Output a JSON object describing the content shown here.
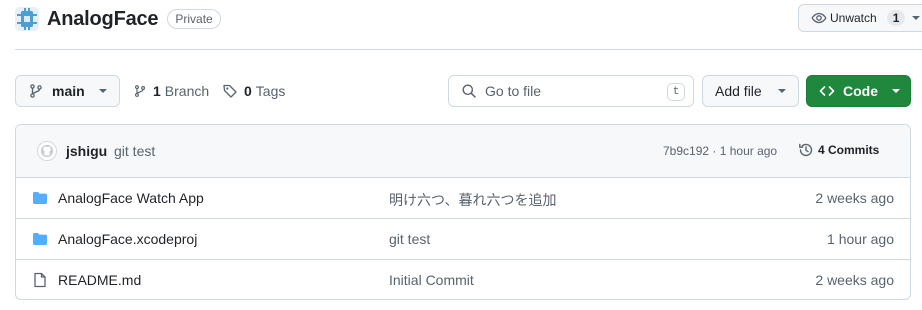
{
  "repo": {
    "name": "AnalogFace",
    "visibility": "Private"
  },
  "watch": {
    "label": "Unwatch",
    "count": "1"
  },
  "toolbar": {
    "branch": "main",
    "branch_count": "1",
    "branch_label": "Branch",
    "tag_count": "0",
    "tag_label": "Tags",
    "search_placeholder": "Go to file",
    "search_shortcut": "t",
    "add_file_label": "Add file",
    "code_label": "Code"
  },
  "latest_commit": {
    "author": "jshigu",
    "message": "git test",
    "meta": "7b9c192 · 1 hour ago",
    "commit_count": "4 Commits"
  },
  "files": [
    {
      "type": "folder",
      "name": "AnalogFace Watch App",
      "message": "明け六つ、暮れ六つを追加",
      "date": "2 weeks ago"
    },
    {
      "type": "folder",
      "name": "AnalogFace.xcodeproj",
      "message": "git test",
      "date": "1 hour ago"
    },
    {
      "type": "file",
      "name": "README.md",
      "message": "Initial Commit",
      "date": "2 weeks ago"
    }
  ],
  "colors": {
    "accent_green": "#1f883d",
    "folder_blue": "#54aeff",
    "border": "#d1d9e0",
    "muted_text": "#59636e"
  }
}
